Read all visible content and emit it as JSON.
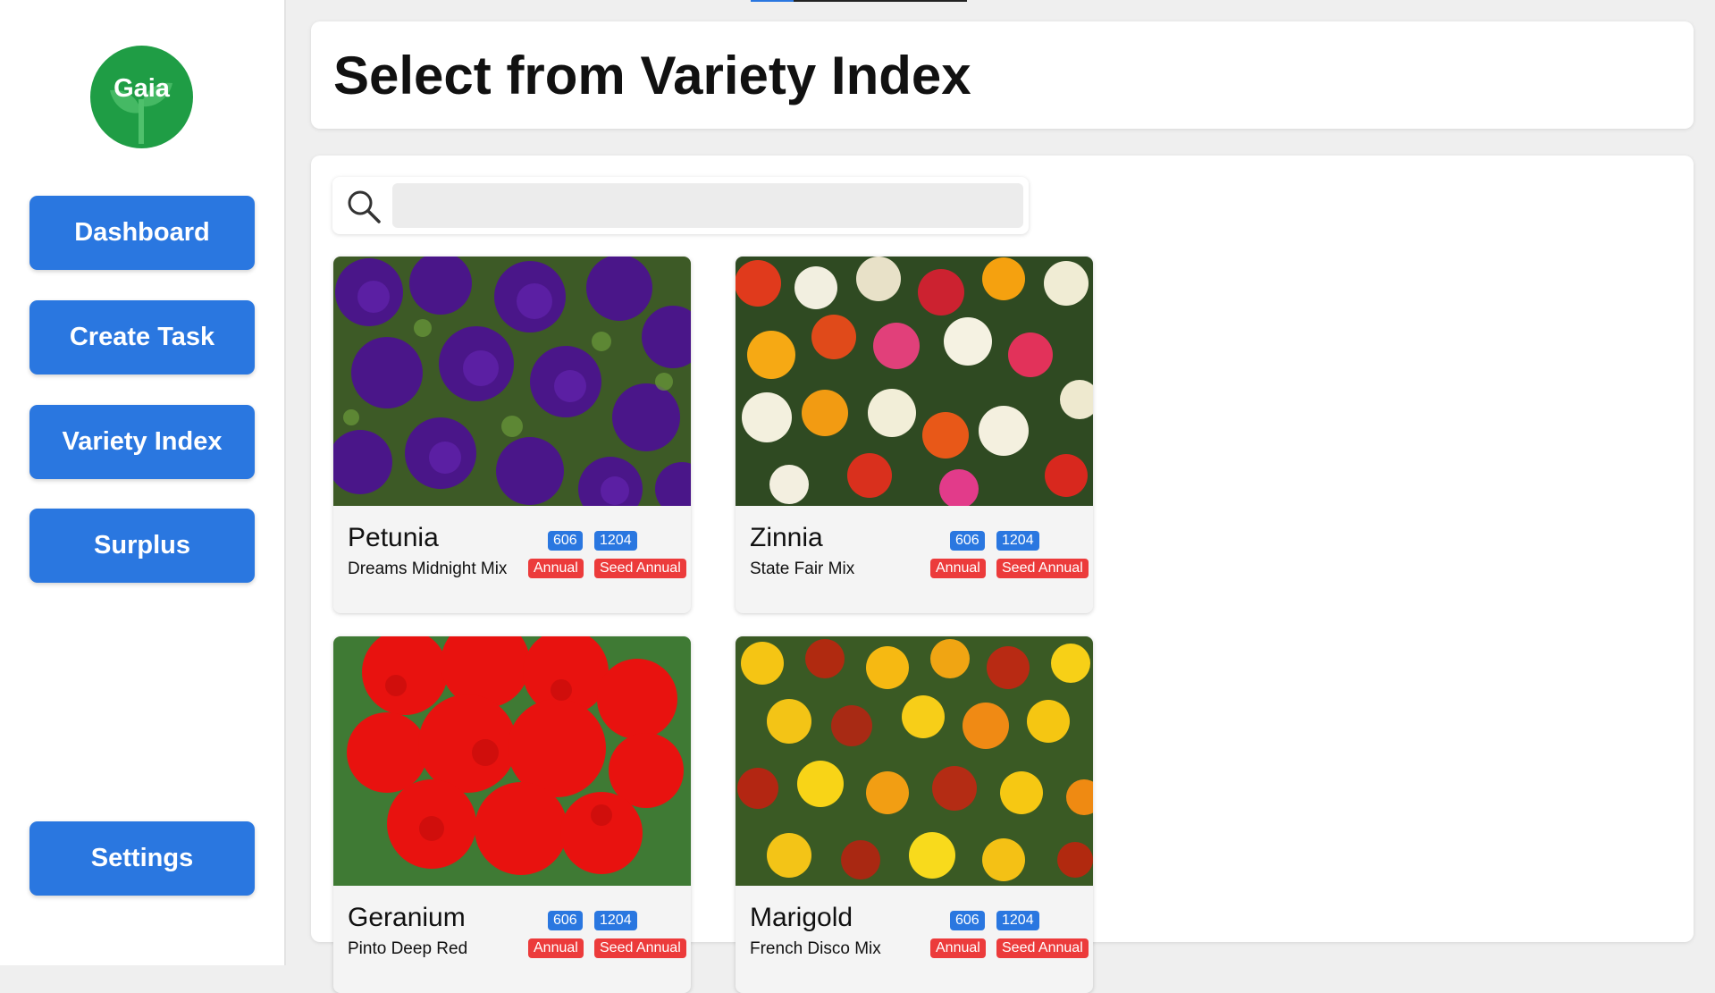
{
  "app": {
    "logo_text": "Gaia"
  },
  "sidebar": {
    "items": [
      {
        "label": "Dashboard"
      },
      {
        "label": "Create Task"
      },
      {
        "label": "Variety Index"
      },
      {
        "label": "Surplus"
      }
    ],
    "settings_label": "Settings"
  },
  "header": {
    "title": "Select from Variety Index"
  },
  "search": {
    "placeholder": "",
    "value": ""
  },
  "cards": [
    {
      "name": "Petunia",
      "variety": "Dreams Midnight Mix",
      "code1": "606",
      "code2": "1204",
      "type": "Annual",
      "category": "Seed Annual",
      "image": "purple petunia flowers"
    },
    {
      "name": "Zinnia",
      "variety": "State Fair Mix",
      "code1": "606",
      "code2": "1204",
      "type": "Annual",
      "category": "Seed Annual",
      "image": "mixed color zinnia flowers"
    },
    {
      "name": "Geranium",
      "variety": "Pinto Deep Red",
      "code1": "606",
      "code2": "1204",
      "type": "Annual",
      "category": "Seed Annual",
      "image": "red geranium flowers"
    },
    {
      "name": "Marigold",
      "variety": "French Disco Mix",
      "code1": "606",
      "code2": "1204",
      "type": "Annual",
      "category": "Seed Annual",
      "image": "yellow and red marigold flowers"
    }
  ],
  "colors": {
    "primary": "#2a77e0",
    "badge_red": "#ec3b3b",
    "logo_green": "#1f9d45"
  }
}
